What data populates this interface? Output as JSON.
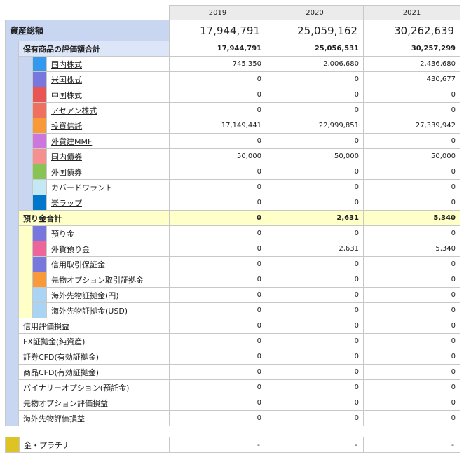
{
  "years": [
    "2019",
    "2020",
    "2021"
  ],
  "total": {
    "label": "資産総額",
    "values": [
      "17,944,791",
      "25,059,162",
      "30,262,639"
    ]
  },
  "holdings": {
    "label": "保有商品の評価額合計",
    "values": [
      "17,944,791",
      "25,056,531",
      "30,257,299"
    ],
    "items": [
      {
        "label": "国内株式",
        "color": "#3399ee",
        "link": true,
        "values": [
          "745,350",
          "2,006,680",
          "2,436,680"
        ]
      },
      {
        "label": "米国株式",
        "color": "#7777dd",
        "link": true,
        "values": [
          "0",
          "0",
          "430,677"
        ]
      },
      {
        "label": "中国株式",
        "color": "#e85555",
        "link": true,
        "values": [
          "0",
          "0",
          "0"
        ]
      },
      {
        "label": "アセアン株式",
        "color": "#f07060",
        "link": true,
        "values": [
          "0",
          "0",
          "0"
        ]
      },
      {
        "label": "投資信託",
        "color": "#f8993a",
        "link": true,
        "values": [
          "17,149,441",
          "22,999,851",
          "27,339,942"
        ]
      },
      {
        "label": "外貨建MMF",
        "color": "#cc77dd",
        "link": true,
        "values": [
          "0",
          "0",
          "0"
        ]
      },
      {
        "label": "国内債券",
        "color": "#f49090",
        "link": true,
        "values": [
          "50,000",
          "50,000",
          "50,000"
        ]
      },
      {
        "label": "外国債券",
        "color": "#88c455",
        "link": true,
        "values": [
          "0",
          "0",
          "0"
        ]
      },
      {
        "label": "カバードワラント",
        "color": "#c4e8f4",
        "link": false,
        "values": [
          "0",
          "0",
          "0"
        ]
      },
      {
        "label": "楽ラップ",
        "color": "#0077cc",
        "link": true,
        "values": [
          "0",
          "0",
          "0"
        ]
      }
    ]
  },
  "deposits": {
    "label": "預り金合計",
    "values": [
      "0",
      "2,631",
      "5,340"
    ],
    "items": [
      {
        "label": "預り金",
        "color": "#7777dd",
        "values": [
          "0",
          "0",
          "0"
        ]
      },
      {
        "label": "外貨預り金",
        "color": "#ee6699",
        "values": [
          "0",
          "2,631",
          "5,340"
        ]
      },
      {
        "label": "信用取引保証金",
        "color": "#7777dd",
        "values": [
          "0",
          "0",
          "0"
        ]
      },
      {
        "label": "先物オプション取引証拠金",
        "color": "#f8993a",
        "values": [
          "0",
          "0",
          "0"
        ]
      },
      {
        "label": "海外先物証拠金(円)",
        "color": "#aad4f4",
        "values": [
          "0",
          "0",
          "0"
        ]
      },
      {
        "label": "海外先物証拠金(USD)",
        "color": "#aad4f4",
        "values": [
          "0",
          "0",
          "0"
        ]
      }
    ]
  },
  "others": [
    {
      "label": "信用評価損益",
      "values": [
        "0",
        "0",
        "0"
      ]
    },
    {
      "label": "FX証拠金(純資産)",
      "values": [
        "0",
        "0",
        "0"
      ]
    },
    {
      "label": "証券CFD(有効証拠金)",
      "values": [
        "0",
        "0",
        "0"
      ]
    },
    {
      "label": "商品CFD(有効証拠金)",
      "values": [
        "0",
        "0",
        "0"
      ]
    },
    {
      "label": "バイナリーオプション(預託金)",
      "values": [
        "0",
        "0",
        "0"
      ]
    },
    {
      "label": "先物オプション評価損益",
      "values": [
        "0",
        "0",
        "0"
      ]
    },
    {
      "label": "海外先物評価損益",
      "values": [
        "0",
        "0",
        "0"
      ]
    }
  ],
  "gold": {
    "label": "金・プラチナ",
    "color": "#ddc422",
    "values": [
      "-",
      "-",
      "-"
    ]
  }
}
